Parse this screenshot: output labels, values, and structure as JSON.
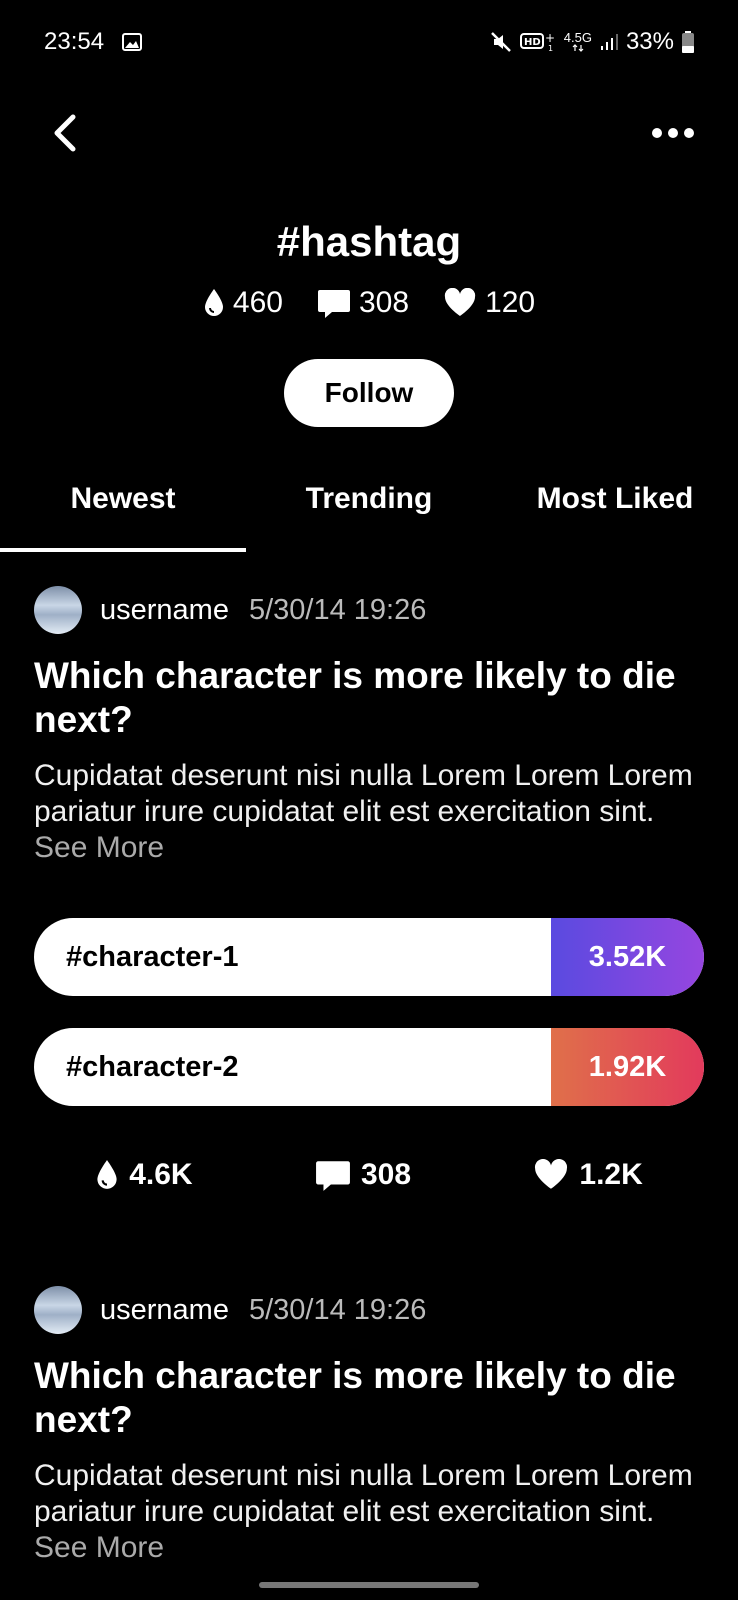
{
  "status_bar": {
    "time": "23:54",
    "network": "4.5G",
    "battery": "33%"
  },
  "header": {
    "hashtag": "#hashtag",
    "stats": {
      "drops": "460",
      "comments": "308",
      "likes": "120"
    },
    "follow_label": "Follow"
  },
  "tabs": [
    {
      "label": "Newest",
      "active": true
    },
    {
      "label": "Trending",
      "active": false
    },
    {
      "label": "Most Liked",
      "active": false
    }
  ],
  "posts": [
    {
      "username": "username",
      "timestamp": "5/30/14 19:26",
      "title": "Which character is more likely to die next?",
      "body": "Cupidatat deserunt nisi nulla Lorem Lorem Lorem pariatur irure cupidatat elit est exercitation sint.",
      "see_more": "See More",
      "options": [
        {
          "label": "#character-1",
          "count": "3.52K",
          "color": "#7a48e0"
        },
        {
          "label": "#character-2",
          "count": "1.92K",
          "color": "#e2505a"
        }
      ],
      "stats": {
        "drops": "4.6K",
        "comments": "308",
        "likes": "1.2K"
      }
    },
    {
      "username": "username",
      "timestamp": "5/30/14 19:26",
      "title": "Which character is more likely to die next?",
      "body": "Cupidatat deserunt nisi nulla Lorem Lorem Lorem pariatur irure cupidatat elit est exercitation sint.",
      "see_more": "See More"
    }
  ],
  "icons": {
    "back": "chevron-left-icon",
    "more": "more-horizontal-icon",
    "drops": "drop-icon",
    "comments": "comment-icon",
    "likes": "heart-icon"
  }
}
